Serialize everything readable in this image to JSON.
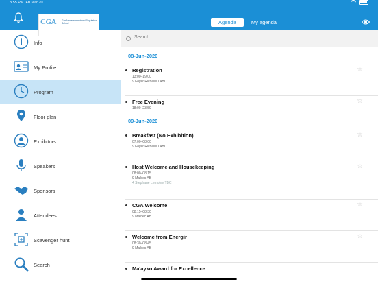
{
  "status": {
    "time": "3:55 PM",
    "date": "Fri Mar 20"
  },
  "sidebar": {
    "logo": {
      "mark": "CGA",
      "text": "Gas Measurement and Regulation School"
    },
    "items": [
      {
        "label": "Info",
        "icon": "info-icon",
        "active": false
      },
      {
        "label": "My Profile",
        "icon": "profile-icon",
        "active": false
      },
      {
        "label": "Program",
        "icon": "clock-icon",
        "active": true
      },
      {
        "label": "Floor plan",
        "icon": "map-pin-icon",
        "active": false
      },
      {
        "label": "Exhibitors",
        "icon": "exhibitors-icon",
        "active": false
      },
      {
        "label": "Speakers",
        "icon": "microphone-icon",
        "active": false
      },
      {
        "label": "Sponsors",
        "icon": "handshake-icon",
        "active": false
      },
      {
        "label": "Attendees",
        "icon": "people-icon",
        "active": false
      },
      {
        "label": "Scavenger hunt",
        "icon": "scavenger-icon",
        "active": false
      },
      {
        "label": "Search",
        "icon": "search-icon",
        "active": false
      }
    ]
  },
  "topbar": {
    "tabs": [
      "Agenda",
      "My agenda"
    ],
    "selected_tab": "Agenda"
  },
  "search": {
    "placeholder": "Search"
  },
  "agenda": {
    "day1": {
      "date": "08-Jun-2020",
      "events": [
        {
          "title": "Registration",
          "time": "13:00–19:00",
          "location": "9 Foyer Richelieu ABC"
        },
        {
          "title": "Free Evening",
          "time": "18:00–23:59"
        }
      ]
    },
    "day2": {
      "date": "09-Jun-2020",
      "events": [
        {
          "title": "Breakfast (No Exhibition)",
          "time": "07:00–08:00",
          "location": "9 Foyer Richelieu ABC"
        },
        {
          "title": "Host Welcome and Housekeeping",
          "time": "08:00–08:15",
          "location": "9 Maibec AB",
          "speaker": "4 Stephane Lemoine TBC"
        },
        {
          "title": "CGA Welcome",
          "time": "08:15–08:30",
          "location": "9 Maibec AB"
        },
        {
          "title": "Welcome from Energir",
          "time": "08:30–08:45",
          "location": "9 Maibec AB"
        },
        {
          "title": "Ma'ayko Award for Excellence"
        }
      ]
    }
  },
  "colors": {
    "brand": "#1b8fd6",
    "active_row": "#c7e4f7"
  }
}
